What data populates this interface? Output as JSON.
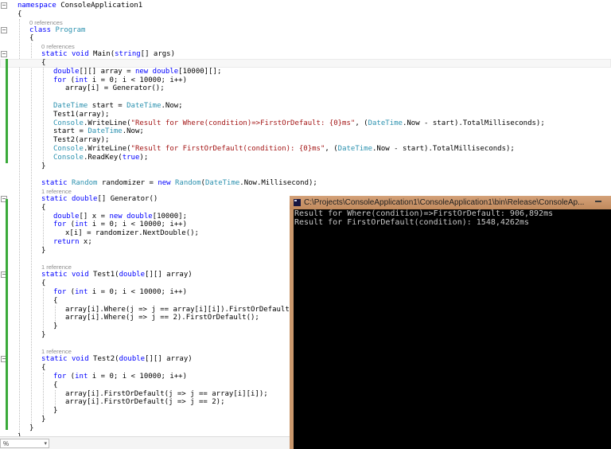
{
  "editor": {
    "colors": {
      "keyword": "#0000ff",
      "type": "#2b91af",
      "string": "#a31515",
      "default": "#000000",
      "codelens": "#8c8c8c",
      "track_changes_saved": "#3aaa3a",
      "background": "#ffffff"
    },
    "lines": [
      {
        "ind": 0,
        "box": true,
        "tok": [
          [
            "k",
            "namespace"
          ],
          [
            "d",
            " ConsoleApplication1"
          ]
        ]
      },
      {
        "ind": 0,
        "tok": [
          [
            "d",
            "{"
          ]
        ]
      },
      {
        "ind": 1,
        "cl": "0 references"
      },
      {
        "ind": 1,
        "box": true,
        "tok": [
          [
            "k",
            "class"
          ],
          [
            "d",
            " "
          ],
          [
            "t",
            "Program"
          ]
        ]
      },
      {
        "ind": 1,
        "tok": [
          [
            "d",
            "{"
          ]
        ]
      },
      {
        "ind": 2,
        "cl": "0 references"
      },
      {
        "ind": 2,
        "box": true,
        "tok": [
          [
            "k",
            "static"
          ],
          [
            "d",
            " "
          ],
          [
            "k",
            "void"
          ],
          [
            "d",
            " Main("
          ],
          [
            "k",
            "string"
          ],
          [
            "d",
            "[] args)"
          ]
        ]
      },
      {
        "ind": 2,
        "cur": true,
        "tok": [
          [
            "d",
            "{"
          ]
        ]
      },
      {
        "ind": 3,
        "tok": [
          [
            "k",
            "double"
          ],
          [
            "d",
            "[][] array = "
          ],
          [
            "k",
            "new"
          ],
          [
            "d",
            " "
          ],
          [
            "k",
            "double"
          ],
          [
            "d",
            "[10000][];"
          ]
        ]
      },
      {
        "ind": 3,
        "tok": [
          [
            "k",
            "for"
          ],
          [
            "d",
            " ("
          ],
          [
            "k",
            "int"
          ],
          [
            "d",
            " i = 0; i < 10000; i++)"
          ]
        ]
      },
      {
        "ind": 4,
        "tok": [
          [
            "d",
            "array[i] = Generator();"
          ]
        ]
      },
      {
        "ind": 0,
        "tok": []
      },
      {
        "ind": 3,
        "tok": [
          [
            "t",
            "DateTime"
          ],
          [
            "d",
            " start = "
          ],
          [
            "t",
            "DateTime"
          ],
          [
            "d",
            ".Now;"
          ]
        ]
      },
      {
        "ind": 3,
        "tok": [
          [
            "d",
            "Test1(array);"
          ]
        ]
      },
      {
        "ind": 3,
        "tok": [
          [
            "t",
            "Console"
          ],
          [
            "d",
            ".WriteLine("
          ],
          [
            "s",
            "\"Result for Where(condition)=>FirstOrDefault: {0}ms\""
          ],
          [
            "d",
            ", ("
          ],
          [
            "t",
            "DateTime"
          ],
          [
            "d",
            ".Now - start).TotalMilliseconds);"
          ]
        ]
      },
      {
        "ind": 3,
        "tok": [
          [
            "d",
            "start = "
          ],
          [
            "t",
            "DateTime"
          ],
          [
            "d",
            ".Now;"
          ]
        ]
      },
      {
        "ind": 3,
        "tok": [
          [
            "d",
            "Test2(array);"
          ]
        ]
      },
      {
        "ind": 3,
        "tok": [
          [
            "t",
            "Console"
          ],
          [
            "d",
            ".WriteLine("
          ],
          [
            "s",
            "\"Result for FirstOrDefault(condition): {0}ms\""
          ],
          [
            "d",
            ", ("
          ],
          [
            "t",
            "DateTime"
          ],
          [
            "d",
            ".Now - start).TotalMilliseconds);"
          ]
        ]
      },
      {
        "ind": 3,
        "tok": [
          [
            "t",
            "Console"
          ],
          [
            "d",
            ".ReadKey("
          ],
          [
            "k",
            "true"
          ],
          [
            "d",
            ");"
          ]
        ]
      },
      {
        "ind": 2,
        "tok": [
          [
            "d",
            "}"
          ]
        ]
      },
      {
        "ind": 0,
        "tok": []
      },
      {
        "ind": 2,
        "tok": [
          [
            "k",
            "static"
          ],
          [
            "d",
            " "
          ],
          [
            "t",
            "Random"
          ],
          [
            "d",
            " randomizer = "
          ],
          [
            "k",
            "new"
          ],
          [
            "d",
            " "
          ],
          [
            "t",
            "Random"
          ],
          [
            "d",
            "("
          ],
          [
            "t",
            "DateTime"
          ],
          [
            "d",
            ".Now.Millisecond);"
          ]
        ]
      },
      {
        "ind": 2,
        "cl": "1 reference"
      },
      {
        "ind": 2,
        "box": true,
        "tok": [
          [
            "k",
            "static"
          ],
          [
            "d",
            " "
          ],
          [
            "k",
            "double"
          ],
          [
            "d",
            "[] Generator()"
          ]
        ]
      },
      {
        "ind": 2,
        "tok": [
          [
            "d",
            "{"
          ]
        ]
      },
      {
        "ind": 3,
        "tok": [
          [
            "k",
            "double"
          ],
          [
            "d",
            "[] x = "
          ],
          [
            "k",
            "new"
          ],
          [
            "d",
            " "
          ],
          [
            "k",
            "double"
          ],
          [
            "d",
            "[10000];"
          ]
        ]
      },
      {
        "ind": 3,
        "tok": [
          [
            "k",
            "for"
          ],
          [
            "d",
            " ("
          ],
          [
            "k",
            "int"
          ],
          [
            "d",
            " i = 0; i < 10000; i++)"
          ]
        ]
      },
      {
        "ind": 4,
        "tok": [
          [
            "d",
            "x[i] = randomizer.NextDouble();"
          ]
        ]
      },
      {
        "ind": 3,
        "tok": [
          [
            "k",
            "return"
          ],
          [
            "d",
            " x;"
          ]
        ]
      },
      {
        "ind": 2,
        "tok": [
          [
            "d",
            "}"
          ]
        ]
      },
      {
        "ind": 0,
        "tok": []
      },
      {
        "ind": 2,
        "cl": "1 reference"
      },
      {
        "ind": 2,
        "box": true,
        "tok": [
          [
            "k",
            "static"
          ],
          [
            "d",
            " "
          ],
          [
            "k",
            "void"
          ],
          [
            "d",
            " Test1("
          ],
          [
            "k",
            "double"
          ],
          [
            "d",
            "[][] array)"
          ]
        ]
      },
      {
        "ind": 2,
        "tok": [
          [
            "d",
            "{"
          ]
        ]
      },
      {
        "ind": 3,
        "tok": [
          [
            "k",
            "for"
          ],
          [
            "d",
            " ("
          ],
          [
            "k",
            "int"
          ],
          [
            "d",
            " i = 0; i < 10000; i++)"
          ]
        ]
      },
      {
        "ind": 3,
        "tok": [
          [
            "d",
            "{"
          ]
        ]
      },
      {
        "ind": 4,
        "tok": [
          [
            "d",
            "array[i].Where(j => j == array[i][i]).FirstOrDefault();"
          ]
        ]
      },
      {
        "ind": 4,
        "tok": [
          [
            "d",
            "array[i].Where(j => j == 2).FirstOrDefault();"
          ]
        ]
      },
      {
        "ind": 3,
        "tok": [
          [
            "d",
            "}"
          ]
        ]
      },
      {
        "ind": 2,
        "tok": [
          [
            "d",
            "}"
          ]
        ]
      },
      {
        "ind": 0,
        "tok": []
      },
      {
        "ind": 2,
        "cl": "1 reference"
      },
      {
        "ind": 2,
        "box": true,
        "tok": [
          [
            "k",
            "static"
          ],
          [
            "d",
            " "
          ],
          [
            "k",
            "void"
          ],
          [
            "d",
            " Test2("
          ],
          [
            "k",
            "double"
          ],
          [
            "d",
            "[][] array)"
          ]
        ]
      },
      {
        "ind": 2,
        "tok": [
          [
            "d",
            "{"
          ]
        ]
      },
      {
        "ind": 3,
        "tok": [
          [
            "k",
            "for"
          ],
          [
            "d",
            " ("
          ],
          [
            "k",
            "int"
          ],
          [
            "d",
            " i = 0; i < 10000; i++)"
          ]
        ]
      },
      {
        "ind": 3,
        "tok": [
          [
            "d",
            "{"
          ]
        ]
      },
      {
        "ind": 4,
        "tok": [
          [
            "d",
            "array[i].FirstOrDefault(j => j == array[i][i]);"
          ]
        ]
      },
      {
        "ind": 4,
        "tok": [
          [
            "d",
            "array[i].FirstOrDefault(j => j == 2);"
          ]
        ]
      },
      {
        "ind": 3,
        "tok": [
          [
            "d",
            "}"
          ]
        ]
      },
      {
        "ind": 2,
        "tok": [
          [
            "d",
            "}"
          ]
        ]
      },
      {
        "ind": 1,
        "tok": [
          [
            "d",
            "}"
          ]
        ]
      },
      {
        "ind": 0,
        "tok": [
          [
            "d",
            "}"
          ]
        ]
      }
    ],
    "zoom_control": {
      "label": "%",
      "caret": "▾"
    }
  },
  "console": {
    "title": "C:\\Projects\\ConsoleApplication1\\ConsoleApplication1\\bin\\Release\\ConsoleAp...",
    "titlebar_color": "#c9976c",
    "text_color": "#c9c9c9",
    "lines": [
      "Result for Where(condition)=>FirstOrDefault: 906,892ms",
      "Result for FirstOrDefault(condition): 1548,4262ms"
    ]
  }
}
